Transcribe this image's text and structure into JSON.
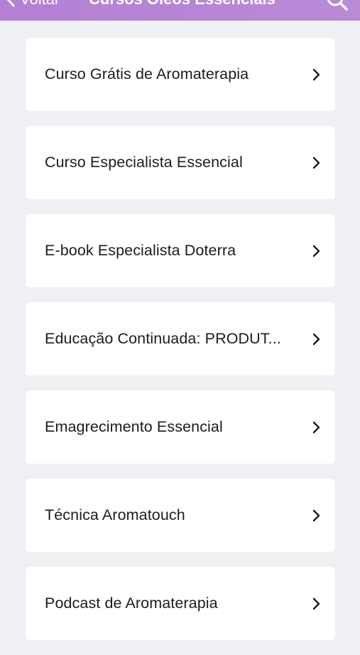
{
  "nav": {
    "back_label": "Voltar",
    "title": "Cursos Óleos Essenciais",
    "icons": {
      "back": "chevron-left-icon",
      "search": "search-icon"
    }
  },
  "items": [
    {
      "label": "Curso Grátis de Aromaterapia"
    },
    {
      "label": "Curso Especialista Essencial"
    },
    {
      "label": "E-book Especialista Doterra"
    },
    {
      "label": "Educação Continuada: PRODUT..."
    },
    {
      "label": "Emagrecimento Essencial"
    },
    {
      "label": "Técnica Aromatouch"
    },
    {
      "label": "Podcast de Aromaterapia"
    }
  ],
  "colors": {
    "nav_background": "#b47fd4",
    "page_background": "#efeff4",
    "card_background": "#ffffff",
    "text": "#1c1c1e"
  }
}
